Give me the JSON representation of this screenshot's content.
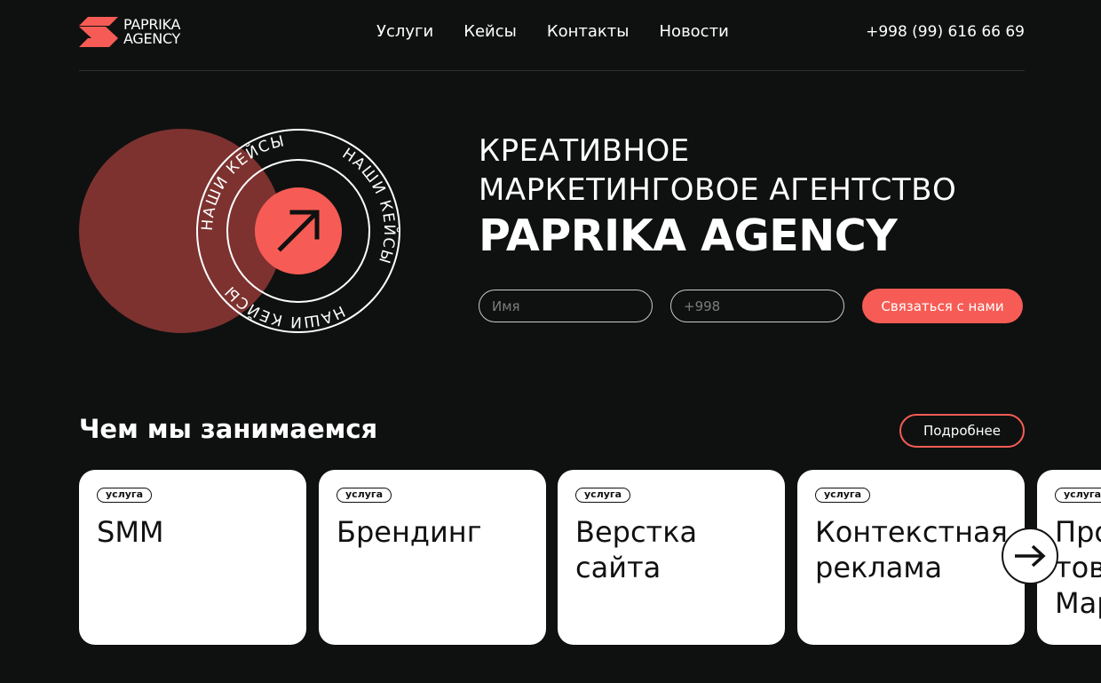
{
  "header": {
    "logo_line1": "PAPRIKA",
    "logo_line2": "AGENCY",
    "nav": [
      "Услуги",
      "Кейсы",
      "Контакты",
      "Новости"
    ],
    "phone": "+998 (99) 616 66 69"
  },
  "hero": {
    "ring_text": "НАШИ КЕЙСЫ",
    "title_line1": "КРЕАТИВНОЕ",
    "title_line2": "МАРКЕТИНГОВОЕ АГЕНТСТВО",
    "brand": "PAPRIKA AGENCY",
    "name_placeholder": "Имя",
    "phone_placeholder": "+998",
    "cta_label": "Связаться с нами"
  },
  "services": {
    "title": "Чем мы занимаемся",
    "more_label": "Подробнее",
    "badge": "услуга",
    "cards": [
      {
        "line1": "SMM",
        "line2": ""
      },
      {
        "line1": "Брендинг",
        "line2": ""
      },
      {
        "line1": "Верстка",
        "line2": "сайта"
      },
      {
        "line1": "Контекстная",
        "line2": "реклама"
      },
      {
        "line1": "Продвижение",
        "line2": "товаров на",
        "line3": "Маркетплейсах"
      }
    ]
  },
  "colors": {
    "background": "#0f1110",
    "accent": "#f65c55",
    "accent_dark": "#7d3230",
    "card": "#ffffff"
  },
  "icons": {
    "hero_button": "arrow-up-right-icon",
    "carousel_next": "arrow-right-icon"
  }
}
